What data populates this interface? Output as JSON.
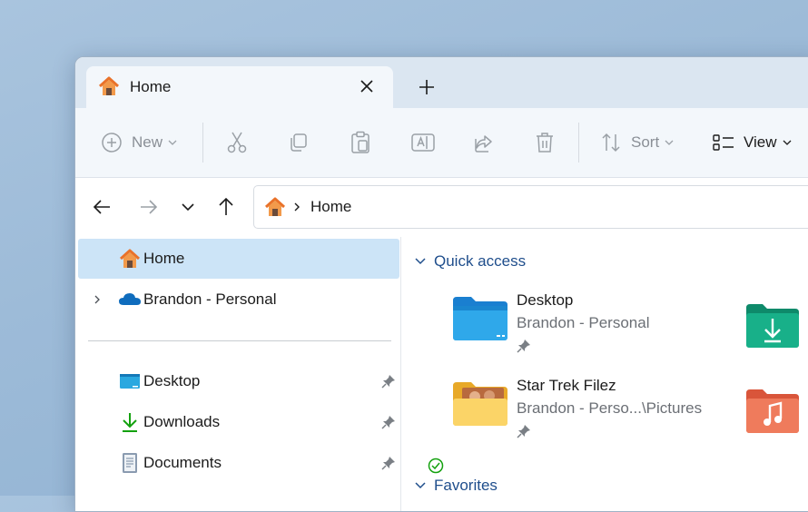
{
  "tab": {
    "title": "Home"
  },
  "toolbar": {
    "new_label": "New",
    "sort_label": "Sort",
    "view_label": "View"
  },
  "address": {
    "location": "Home"
  },
  "sidebar": {
    "items": [
      {
        "label": "Home"
      },
      {
        "label": "Brandon - Personal"
      },
      {
        "label": "Desktop"
      },
      {
        "label": "Downloads"
      },
      {
        "label": "Documents"
      }
    ]
  },
  "main": {
    "quick_access_title": "Quick access",
    "favorites_title": "Favorites",
    "items": [
      {
        "name": "Desktop",
        "sub": "Brandon - Personal"
      },
      {
        "name": "Star Trek Filez",
        "sub": "Brandon - Perso...\\Pictures"
      }
    ]
  },
  "colors": {
    "accent": "#1f4e8c",
    "selection": "#cce4f7",
    "toolbar_bg": "#f3f7fb",
    "titlebar_bg": "#dbe6f1"
  }
}
